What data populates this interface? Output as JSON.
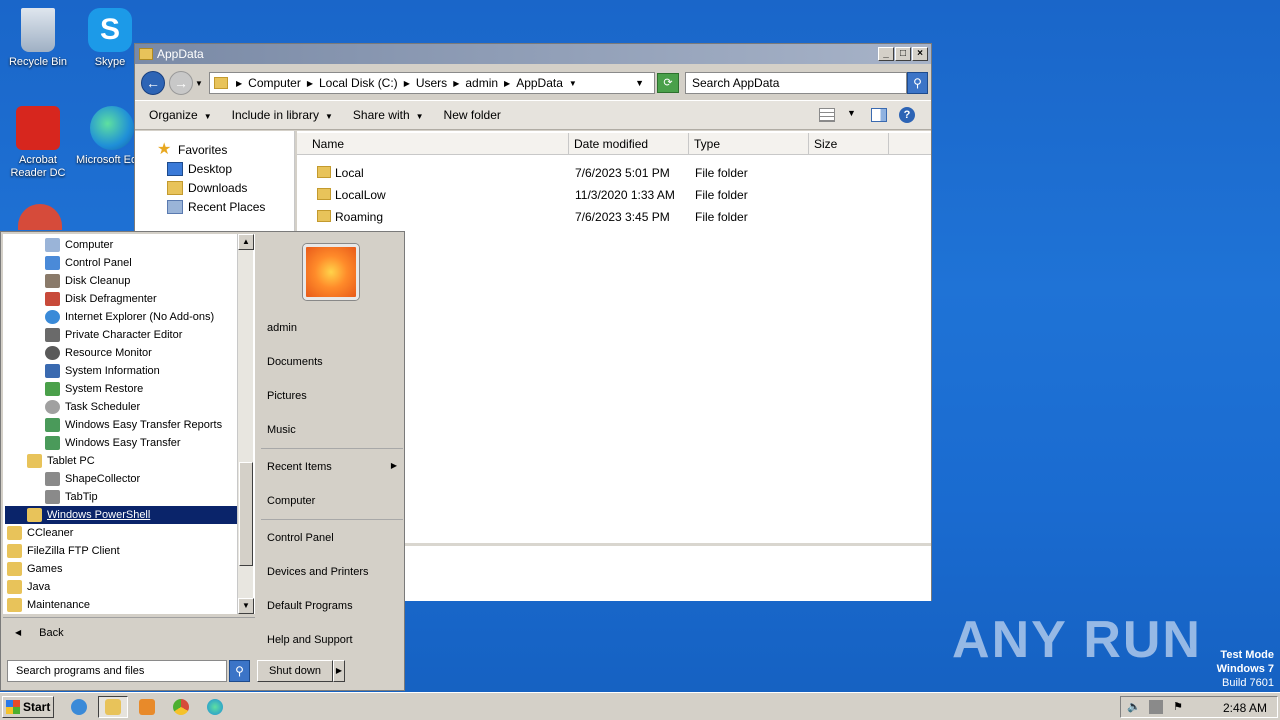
{
  "desktop": {
    "icons": [
      {
        "label": "Recycle Bin"
      },
      {
        "label": "Skype"
      },
      {
        "label": "Acrobat Reader DC"
      },
      {
        "label": "Microsoft Edge"
      }
    ],
    "watermark": "ANY RUN",
    "test_mode": {
      "line1": "Test Mode",
      "line2": "Windows 7",
      "line3": "Build 7601"
    }
  },
  "explorer": {
    "title": "AppData",
    "breadcrumb": [
      "Computer",
      "Local Disk (C:)",
      "Users",
      "admin",
      "AppData"
    ],
    "search_placeholder": "Search AppData",
    "toolbar": {
      "organize": "Organize",
      "include": "Include in library",
      "share": "Share with",
      "new_folder": "New folder"
    },
    "nav": {
      "favorites": "Favorites",
      "desktop": "Desktop",
      "downloads": "Downloads",
      "recent": "Recent Places"
    },
    "columns": {
      "name": "Name",
      "date": "Date modified",
      "type": "Type",
      "size": "Size"
    },
    "files": [
      {
        "name": "Local",
        "date": "7/6/2023 5:01 PM",
        "type": "File folder"
      },
      {
        "name": "LocalLow",
        "date": "11/3/2020 1:33 AM",
        "type": "File folder"
      },
      {
        "name": "Roaming",
        "date": "7/6/2023 3:45 PM",
        "type": "File folder"
      }
    ]
  },
  "start_menu": {
    "programs": [
      {
        "label": "Computer"
      },
      {
        "label": "Control Panel"
      },
      {
        "label": "Disk Cleanup"
      },
      {
        "label": "Disk Defragmenter"
      },
      {
        "label": "Internet Explorer (No Add-ons)"
      },
      {
        "label": "Private Character Editor"
      },
      {
        "label": "Resource Monitor"
      },
      {
        "label": "System Information"
      },
      {
        "label": "System Restore"
      },
      {
        "label": "Task Scheduler"
      },
      {
        "label": "Windows Easy Transfer Reports"
      },
      {
        "label": "Windows Easy Transfer"
      },
      {
        "label": "Tablet PC"
      },
      {
        "label": "ShapeCollector"
      },
      {
        "label": "TabTip"
      },
      {
        "label": "Windows PowerShell"
      },
      {
        "label": "CCleaner"
      },
      {
        "label": "FileZilla FTP Client"
      },
      {
        "label": "Games"
      },
      {
        "label": "Java"
      },
      {
        "label": "Maintenance"
      }
    ],
    "back": "Back",
    "search_placeholder": "Search programs and files",
    "right": {
      "user": "admin",
      "documents": "Documents",
      "pictures": "Pictures",
      "music": "Music",
      "recent_items": "Recent Items",
      "computer": "Computer",
      "control_panel": "Control Panel",
      "devices": "Devices and Printers",
      "default_programs": "Default Programs",
      "help": "Help and Support"
    },
    "shutdown": "Shut down"
  },
  "taskbar": {
    "start": "Start",
    "clock": "2:48 AM"
  }
}
